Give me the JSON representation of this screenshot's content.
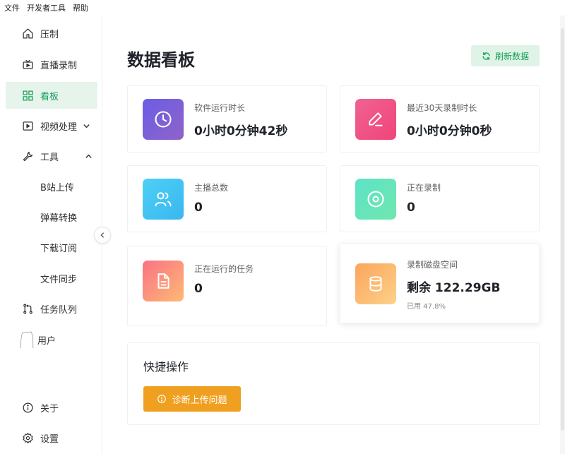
{
  "menubar": {
    "items": [
      "文件",
      "开发者工具",
      "帮助"
    ]
  },
  "sidebar": {
    "items": [
      {
        "label": "压制",
        "icon": "home-icon"
      },
      {
        "label": "直播录制",
        "icon": "tv-icon"
      },
      {
        "label": "看板",
        "icon": "dashboard-icon",
        "active": true
      },
      {
        "label": "视频处理",
        "icon": "play-icon",
        "expandable": "collapsed"
      },
      {
        "label": "工具",
        "icon": "wrench-icon",
        "expandable": "expanded"
      },
      {
        "label": "任务队列",
        "icon": "git-icon"
      },
      {
        "label": "用户",
        "icon": "user-avatar"
      }
    ],
    "tools_sub": [
      "B站上传",
      "弹幕转换",
      "下载订阅",
      "文件同步"
    ],
    "bottom": [
      {
        "label": "关于",
        "icon": "info-icon"
      },
      {
        "label": "设置",
        "icon": "gear-icon"
      }
    ]
  },
  "main": {
    "title": "数据看板",
    "refresh_label": "刷新数据",
    "cards": [
      {
        "label": "软件运行时长",
        "value": "0小时0分钟42秒",
        "icon": "clock-icon",
        "gradient": [
          "#6c5ce7",
          "#8e64c8"
        ]
      },
      {
        "label": "最近30天录制时长",
        "value": "0小时0分钟0秒",
        "icon": "edit-icon",
        "gradient": [
          "#f06292",
          "#f0457a"
        ]
      },
      {
        "label": "主播总数",
        "value": "0",
        "icon": "users-icon",
        "gradient": [
          "#4dd0f5",
          "#3ab7f0"
        ]
      },
      {
        "label": "正在录制",
        "value": "0",
        "icon": "record-icon",
        "gradient": [
          "#5ee3c6",
          "#6fe6b0"
        ]
      },
      {
        "label": "正在运行的任务",
        "value": "0",
        "icon": "document-icon",
        "gradient": [
          "#fb7185",
          "#fdba74"
        ]
      },
      {
        "label": "录制磁盘空间",
        "value": "剩余 122.29GB",
        "sub": "已用 47.8%",
        "icon": "database-icon",
        "gradient": [
          "#fba55c",
          "#fdd18a"
        ]
      }
    ],
    "quick": {
      "title": "快捷操作",
      "button_label": "诊断上传问题"
    }
  }
}
